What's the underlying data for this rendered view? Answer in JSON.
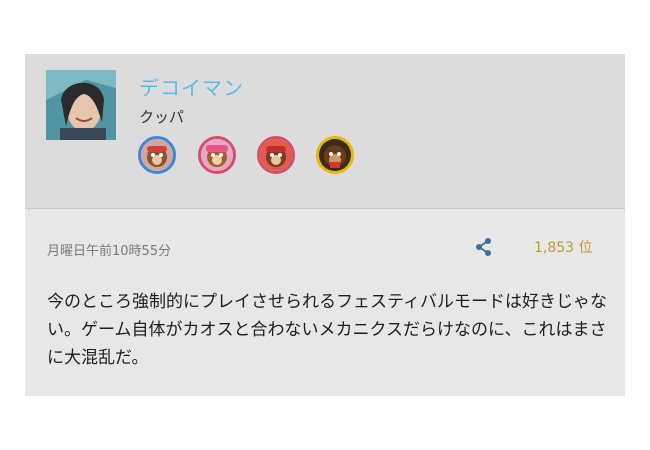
{
  "post": {
    "user_name": "デコイマン",
    "team_name": "クッパ",
    "badges": [
      {
        "icon": "fighter-badge-icon-1",
        "border_color": "#3f86d8"
      },
      {
        "icon": "fighter-badge-icon-2",
        "border_color": "#d0506b"
      },
      {
        "icon": "fighter-badge-icon-3",
        "border_color": "#d0506b"
      },
      {
        "icon": "fighter-badge-icon-4",
        "border_color": "#e6b900"
      }
    ],
    "timestamp": "月曜日午前10時55分",
    "share_icon": "share-icon",
    "rank": "1,853 位",
    "body": "今のところ強制的にプレイさせられるフェスティバルモードは好きじゃない。ゲーム自体がカオスと合わないメカニクスだらけなのに、これはまさに大混乱だ。"
  },
  "colors": {
    "user_name": "#58bde9",
    "rank": "#c59a2e",
    "header_bg": "#dcdcdc",
    "body_bg": "#e7e7e7"
  }
}
